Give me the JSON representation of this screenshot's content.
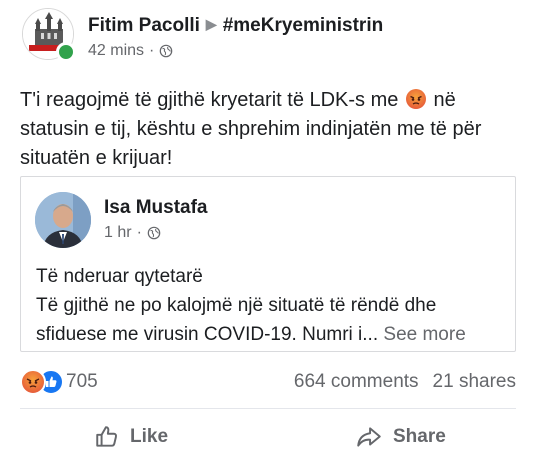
{
  "post": {
    "author": "Fitim Pacolli",
    "separator": "▶",
    "target_page": "#meKryeministrin",
    "time": "42 mins",
    "dot": "·",
    "text_before_emoji": "T'i reagojmë të gjithë kryetarit të LDK-s me ",
    "text_after_emoji": " në statusin e tij, kështu e shprehim indinjatën me të për situatën e krijuar!",
    "emoji": "angry-emoji"
  },
  "shared": {
    "author": "Isa Mustafa",
    "time": "1 hr",
    "dot": "·",
    "line1": "Të nderuar qytetarë",
    "line2": "Të gjithë ne po kalojmë një situatë të rëndë dhe sfiduese me virusin COVID-19. Numri i",
    "ellipsis": "... ",
    "see_more": "See more"
  },
  "reactions": {
    "icons": [
      "angry-reaction-icon",
      "like-reaction-icon"
    ],
    "count": "705",
    "comments": "664 comments",
    "shares": "21 shares"
  },
  "actions": {
    "like": "Like",
    "share": "Share"
  },
  "colors": {
    "text": "#1c1e21",
    "secondary": "#65676b",
    "online": "#31a24c",
    "like_blue": "#1877f2",
    "angry_orange": "#e8623a"
  }
}
